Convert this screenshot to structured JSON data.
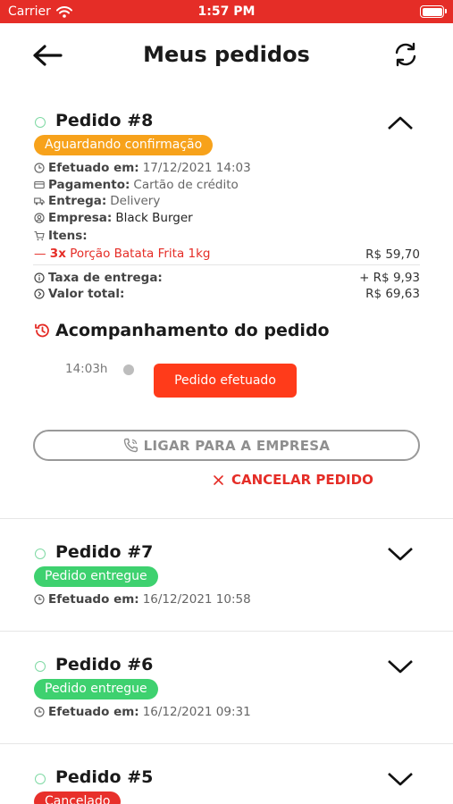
{
  "status_bar": {
    "carrier": "Carrier",
    "time": "1:57 PM"
  },
  "header": {
    "title": "Meus pedidos"
  },
  "colors": {
    "brand_red": "#e52d27",
    "status_orange": "#f7a21b",
    "status_green": "#3ed16f",
    "status_red": "#e8302b"
  },
  "orders": [
    {
      "title": "Pedido #8",
      "status": "Aguardando confirmação",
      "details": {
        "efetuado_label": "Efetuado em:",
        "efetuado_value": "17/12/2021 14:03",
        "pagamento_label": "Pagamento:",
        "pagamento_value": "Cartão de crédito",
        "entrega_label": "Entrega:",
        "entrega_value": "Delivery",
        "empresa_label": "Empresa:",
        "empresa_value": "Black Burger",
        "itens_label": "Itens:"
      },
      "items": [
        {
          "dash": "—",
          "qty": "3x",
          "name": "Porção Batata Frita 1kg",
          "price": "R$ 59,70"
        }
      ],
      "taxa_label": "Taxa de entrega:",
      "taxa_value": "+ R$ 9,93",
      "total_label": "Valor total:",
      "total_value": "R$ 69,63",
      "tracking": {
        "title": "Acompanhamento do pedido",
        "steps": [
          {
            "time": "14:03h",
            "label": "Pedido efetuado"
          }
        ]
      },
      "call_label": "LIGAR PARA A EMPRESA",
      "cancel_label": "CANCELAR PEDIDO"
    },
    {
      "title": "Pedido #7",
      "status": "Pedido entregue",
      "efetuado_label": "Efetuado em:",
      "efetuado_value": "16/12/2021 10:58"
    },
    {
      "title": "Pedido #6",
      "status": "Pedido entregue",
      "efetuado_label": "Efetuado em:",
      "efetuado_value": "16/12/2021 09:31"
    },
    {
      "title": "Pedido #5",
      "status": "Cancelado"
    }
  ]
}
